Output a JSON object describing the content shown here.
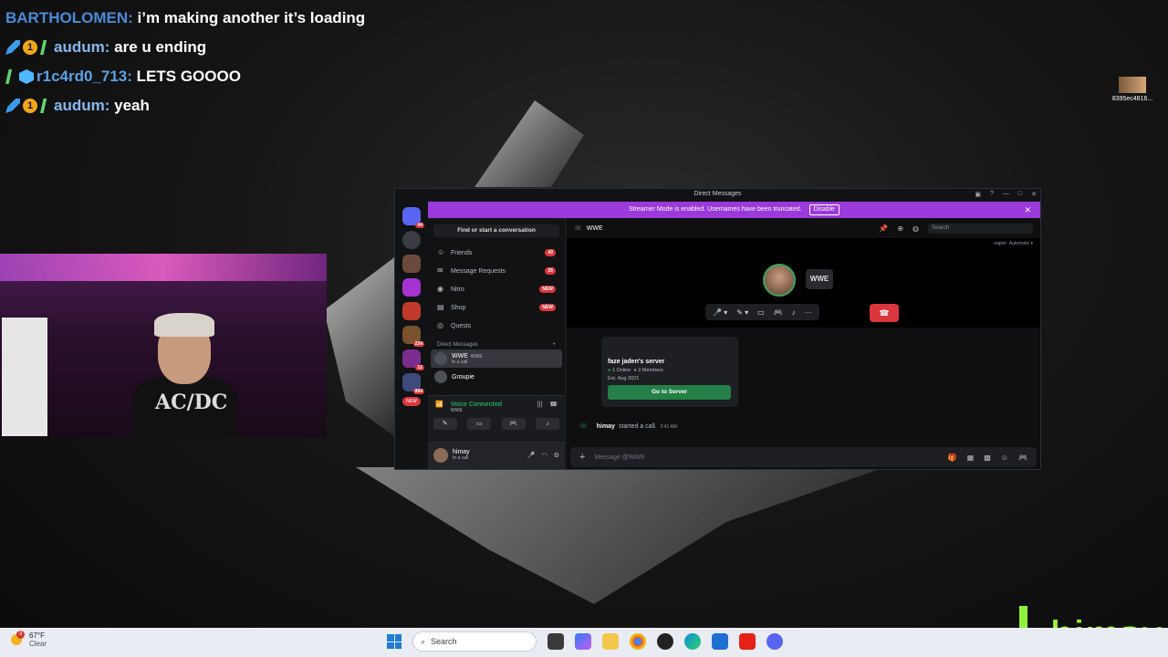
{
  "chat": [
    {
      "user": "BARTHOLOMEN:",
      "message": "i’m making another it’s loading",
      "badges": []
    },
    {
      "user": "audum:",
      "message": "are u ending",
      "badges": [
        "sword-icon",
        "1",
        "stripe-icon"
      ]
    },
    {
      "user": "r1c4rd0_713:",
      "message": "LETS GOOOO",
      "badges": [
        "stripe-icon",
        "cube-icon"
      ]
    },
    {
      "user": "audum:",
      "message": "yeah",
      "badges": [
        "sword-icon",
        "1",
        "stripe-icon"
      ]
    }
  ],
  "webcam": {
    "shirt_text": "AC/DC"
  },
  "desktop_icon": {
    "label": "8395ec4816..."
  },
  "discord": {
    "window_title": "Direct Messages",
    "banner": {
      "text": "Streamer Mode is enabled. Usernames have been truncated.",
      "button": "Disable",
      "close": "✕"
    },
    "guild_badges": [
      "44",
      "234",
      "12",
      "994",
      "NEW"
    ],
    "find": "Find or start a conversation",
    "nav": [
      {
        "label": "Friends",
        "badge": "43"
      },
      {
        "label": "Message Requests",
        "badge": "25"
      },
      {
        "label": "Nitro",
        "badge": "NEW"
      },
      {
        "label": "Shop",
        "badge": "NEW"
      },
      {
        "label": "Quests",
        "badge": ""
      }
    ],
    "dm_header": "Direct Messages",
    "dm_add": "+",
    "dms": [
      {
        "name": "WWE",
        "tag": "WWE",
        "sub": "In a call"
      },
      {
        "name": "Groupie",
        "tag": "",
        "sub": ""
      }
    ],
    "voice": {
      "status": "Voice Connected",
      "channel": "WWE"
    },
    "user": {
      "name": "himay",
      "sub": "In a call"
    },
    "channel": {
      "name": "WWE",
      "search_placeholder": "Search",
      "region_label": "region",
      "region_value": "Automatic"
    },
    "call_avatar2": "WWE",
    "server_card": {
      "name": "faze jaden's server",
      "online": "1 Online",
      "members": "2 Members",
      "established": "Est. Aug 2021",
      "button": "Go to Server"
    },
    "system_message": {
      "user": "himay",
      "text": "started a call.",
      "time": "2:41 AM"
    },
    "composer_placeholder": "Message @WWE"
  },
  "taskbar": {
    "weather_temp": "67°F",
    "weather_desc": "Clear",
    "weather_badge": "3",
    "search": "Search"
  },
  "overlay_logo": "himay",
  "colors": {
    "streamer_banner": "#9b3adb",
    "discord_green": "#248046",
    "hangup": "#da373c",
    "logo_green": "#9bff31"
  }
}
